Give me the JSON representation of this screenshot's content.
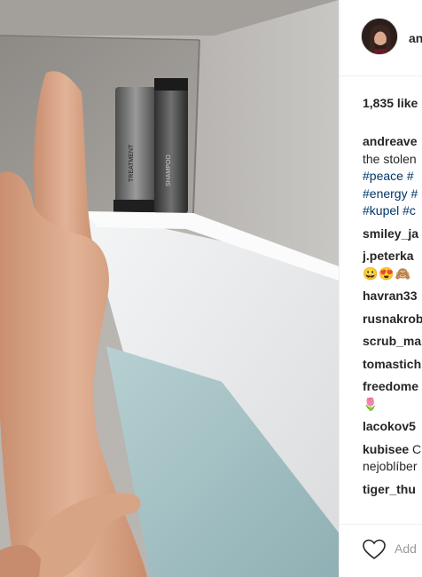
{
  "post": {
    "username": "andreave",
    "likes": "1,835 like",
    "add_comment_placeholder": "Add"
  },
  "caption": {
    "user": "andreave",
    "lines": [
      "the stolen",
      "#peace #",
      "#energy #",
      "#kupel #c"
    ]
  },
  "comments": [
    {
      "user": "smiley_ja"
    },
    {
      "user": "j.peterka",
      "emoji": "😀😍🙈"
    },
    {
      "user": "havran33"
    },
    {
      "user": "rusnakrob"
    },
    {
      "user": "scrub_ma"
    },
    {
      "user": "tomastich"
    },
    {
      "user": "freedome",
      "emoji": "🌷"
    },
    {
      "user": "lacokov5"
    },
    {
      "user": "kubisee",
      "text": "C",
      "line2": "nejoblíber"
    },
    {
      "user": "tiger_thu"
    }
  ],
  "icons": {
    "heart": "heart-outline-icon",
    "avatar": "profile-avatar"
  },
  "colors": {
    "hashtag": "#003569",
    "username": "#262626",
    "placeholder": "#999999",
    "divider": "#efefef"
  },
  "photo": {
    "products": [
      {
        "label": "TREATMENT"
      },
      {
        "label": "SHAMPOO"
      }
    ]
  }
}
